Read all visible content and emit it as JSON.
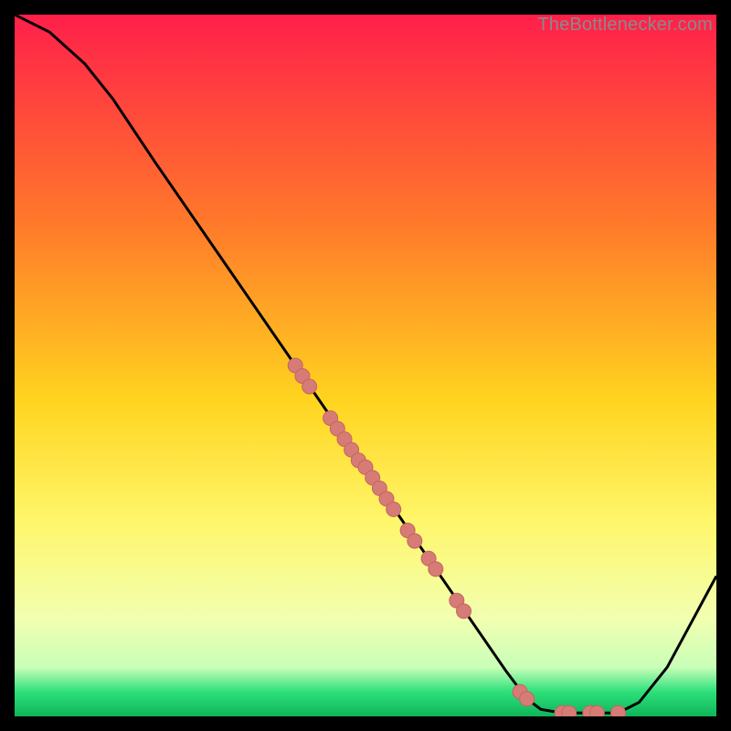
{
  "watermark": "TheBottlenecker.com",
  "colors": {
    "curve": "#000000",
    "marker_fill": "#d77b77",
    "marker_stroke": "#c46560",
    "frame_bg": "#000000",
    "gradient_top": "#ff1f4a",
    "gradient_mid1": "#ff7a2a",
    "gradient_mid2": "#ffd41f",
    "gradient_mid3": "#fff66a",
    "gradient_mid4": "#f2ffb0",
    "gradient_bottom_band": "#2de07a",
    "gradient_bottom": "#0fb558"
  },
  "chart_data": {
    "type": "line",
    "title": "",
    "xlabel": "",
    "ylabel": "",
    "xlim": [
      0,
      100
    ],
    "ylim": [
      0,
      100
    ],
    "curve": [
      {
        "x": 0,
        "y": 100
      },
      {
        "x": 5,
        "y": 97.5
      },
      {
        "x": 10,
        "y": 93
      },
      {
        "x": 14,
        "y": 88
      },
      {
        "x": 20,
        "y": 79
      },
      {
        "x": 30,
        "y": 64.5
      },
      {
        "x": 40,
        "y": 50
      },
      {
        "x": 50,
        "y": 35.5
      },
      {
        "x": 60,
        "y": 21
      },
      {
        "x": 70,
        "y": 6.5
      },
      {
        "x": 73,
        "y": 2.5
      },
      {
        "x": 75,
        "y": 1
      },
      {
        "x": 78,
        "y": 0.5
      },
      {
        "x": 86,
        "y": 0.5
      },
      {
        "x": 89,
        "y": 2
      },
      {
        "x": 93,
        "y": 7
      },
      {
        "x": 100,
        "y": 20
      }
    ],
    "markers": [
      {
        "x": 40,
        "y": 50
      },
      {
        "x": 41,
        "y": 48.5
      },
      {
        "x": 42,
        "y": 47
      },
      {
        "x": 45,
        "y": 42.5
      },
      {
        "x": 46,
        "y": 41
      },
      {
        "x": 47,
        "y": 39.5
      },
      {
        "x": 48,
        "y": 38
      },
      {
        "x": 49,
        "y": 36.5
      },
      {
        "x": 50,
        "y": 35.5
      },
      {
        "x": 51,
        "y": 34
      },
      {
        "x": 52,
        "y": 32.5
      },
      {
        "x": 53,
        "y": 31
      },
      {
        "x": 54,
        "y": 29.5
      },
      {
        "x": 56,
        "y": 26.5
      },
      {
        "x": 57,
        "y": 25
      },
      {
        "x": 59,
        "y": 22.5
      },
      {
        "x": 60,
        "y": 21
      },
      {
        "x": 63,
        "y": 16.5
      },
      {
        "x": 64,
        "y": 15
      },
      {
        "x": 72,
        "y": 3.5
      },
      {
        "x": 73,
        "y": 2.5
      },
      {
        "x": 78,
        "y": 0.5
      },
      {
        "x": 79,
        "y": 0.5
      },
      {
        "x": 82,
        "y": 0.5
      },
      {
        "x": 83,
        "y": 0.5
      },
      {
        "x": 86,
        "y": 0.5
      }
    ],
    "marker_radius": 8
  }
}
